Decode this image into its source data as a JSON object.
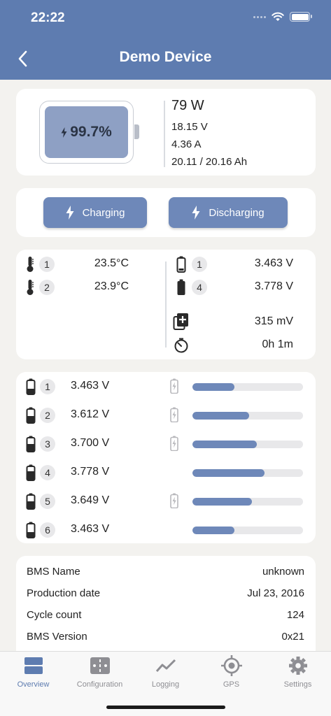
{
  "status_bar": {
    "time": "22:22"
  },
  "header": {
    "title": "Demo Device",
    "back_icon": "chevron-left-icon"
  },
  "summary": {
    "soc": "99.7%",
    "power": "79 W",
    "voltage": "18.15 V",
    "current": "4.36 A",
    "capacity": "20.11 / 20.16 Ah"
  },
  "controls": {
    "charging_label": "Charging",
    "discharging_label": "Discharging"
  },
  "stats": {
    "temps": [
      {
        "index": "1",
        "value": "23.5°C"
      },
      {
        "index": "2",
        "value": "23.9°C"
      }
    ],
    "min_cell": {
      "index": "1",
      "value": "3.463 V"
    },
    "max_cell": {
      "index": "4",
      "value": "3.778 V"
    },
    "delta": "315 mV",
    "runtime": "0h 1m"
  },
  "cells": [
    {
      "index": "1",
      "voltage": "3.463 V",
      "balancing": true,
      "level": 0.38
    },
    {
      "index": "2",
      "voltage": "3.612 V",
      "balancing": true,
      "level": 0.51
    },
    {
      "index": "3",
      "voltage": "3.700 V",
      "balancing": true,
      "level": 0.58
    },
    {
      "index": "4",
      "voltage": "3.778 V",
      "balancing": false,
      "level": 0.65
    },
    {
      "index": "5",
      "voltage": "3.649 V",
      "balancing": true,
      "level": 0.54
    },
    {
      "index": "6",
      "voltage": "3.463 V",
      "balancing": false,
      "level": 0.38
    }
  ],
  "info": [
    {
      "label": "BMS Name",
      "value": "unknown"
    },
    {
      "label": "Production date",
      "value": "Jul 23, 2016"
    },
    {
      "label": "Cycle count",
      "value": "124"
    },
    {
      "label": "BMS Version",
      "value": "0x21"
    }
  ],
  "tabs": [
    {
      "label": "Overview",
      "icon": "overview-icon",
      "active": true
    },
    {
      "label": "Configuration",
      "icon": "configuration-icon",
      "active": false
    },
    {
      "label": "Logging",
      "icon": "logging-icon",
      "active": false
    },
    {
      "label": "GPS",
      "icon": "gps-icon",
      "active": false
    },
    {
      "label": "Settings",
      "icon": "gear-icon",
      "active": false
    }
  ],
  "colors": {
    "accent": "#5e7cb0",
    "button": "#6e88b9",
    "battery_fill": "#8ea0c4",
    "background": "#f3f2ef"
  }
}
